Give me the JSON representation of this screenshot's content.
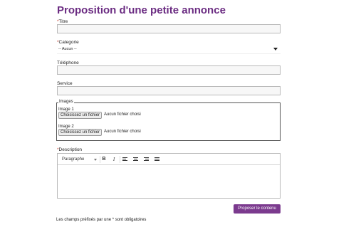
{
  "page": {
    "title": "Proposition d'une petite annonce"
  },
  "form": {
    "required_marker": "*",
    "titre": {
      "label": "Titre",
      "value": ""
    },
    "categorie": {
      "label": "Categorie",
      "selected": "-- Aucun --"
    },
    "telephone": {
      "label": "Téléphone",
      "value": ""
    },
    "service": {
      "label": "Service",
      "value": ""
    },
    "images": {
      "legend": "Images",
      "items": [
        {
          "label": "Image 1",
          "button": "Choisissez un fichier",
          "status": "Aucun fichier choisi"
        },
        {
          "label": "Image 2",
          "button": "Choisissez un fichier",
          "status": "Aucun fichier choisi"
        }
      ]
    },
    "description": {
      "label": "Description",
      "toolbar": {
        "format": "Paragraphe",
        "bold": "B",
        "italic": "I"
      },
      "content": ""
    },
    "submit_label": "Proposer le contenu",
    "footnote": "Les champs préfixés par une * sont obligatoires"
  },
  "colors": {
    "accent": "#7b3a8e",
    "title": "#6b2c82",
    "required": "#c0392b"
  }
}
